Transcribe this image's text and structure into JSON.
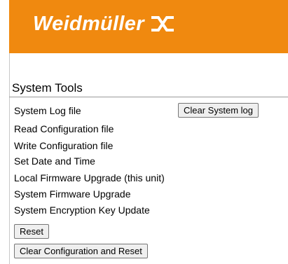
{
  "header": {
    "brand": "Weidmüller",
    "logo_icon": "weidmuller-cross-icon",
    "color": "#f0890f"
  },
  "section": {
    "title": "System Tools"
  },
  "menu": {
    "items": [
      "System Log file",
      "Read Configuration file",
      "Write Configuration file",
      "Set Date and Time",
      "Local Firmware Upgrade (this unit)",
      "System Firmware Upgrade",
      "System Encryption Key Update"
    ]
  },
  "buttons": {
    "clear_system_log": "Clear System log",
    "reset": "Reset",
    "clear_config_reset": "Clear Configuration and Reset"
  }
}
